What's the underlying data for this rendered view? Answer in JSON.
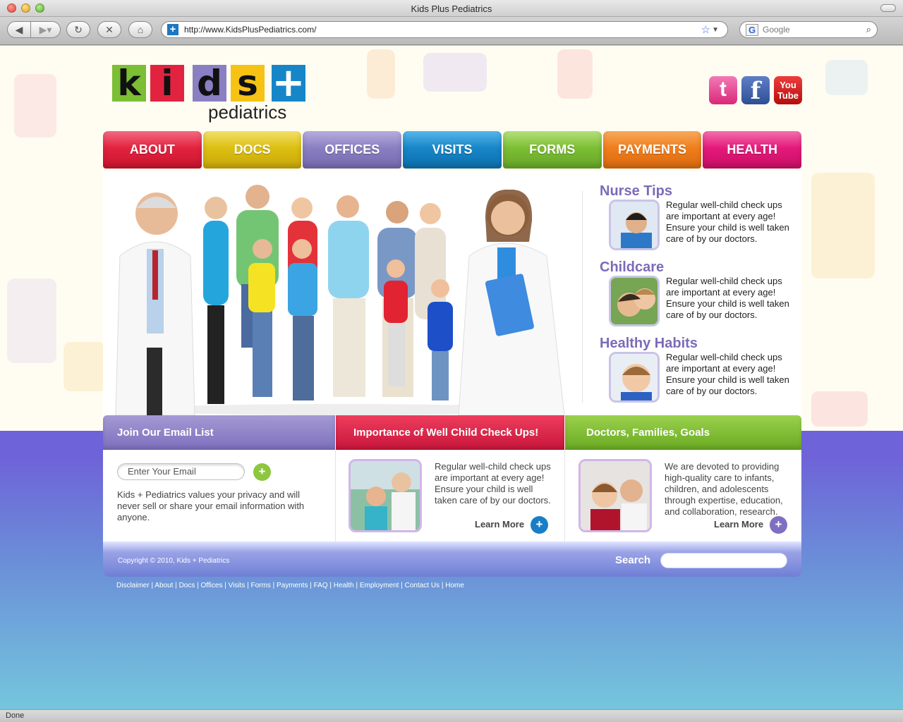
{
  "window": {
    "title": "Kids Plus Pediatrics"
  },
  "browser": {
    "url": "http://www.KidsPlusPediatrics.com/",
    "search_placeholder": "Google",
    "status": "Done"
  },
  "logo": {
    "letters": [
      "k",
      "i",
      "d",
      "s",
      "+"
    ],
    "subtitle": "pediatrics"
  },
  "social": [
    {
      "name": "twitter",
      "glyph": "t",
      "color": "#e83d8e"
    },
    {
      "name": "facebook",
      "glyph": "f",
      "color": "#3b5998"
    },
    {
      "name": "youtube",
      "glyph": "You Tube",
      "color": "#d9161a"
    }
  ],
  "nav": [
    "ABOUT",
    "DOCS",
    "OFFICES",
    "VISITS",
    "FORMS",
    "PAYMENTS",
    "HEALTH"
  ],
  "colors": {
    "nav": [
      "#e2233f",
      "#dcbf12",
      "#8a7fc2",
      "#1786c9",
      "#7cbe34",
      "#f07e1d",
      "#e5197a"
    ],
    "accent_purple": "#7c6bb8",
    "accent_blue": "#1a7ec6"
  },
  "tips": [
    {
      "title": "Nurse Tips",
      "text": "Regular well-child check ups are important at every age! Ensure your child is well taken care of by our doctors."
    },
    {
      "title": "Childcare",
      "text": "Regular well-child check ups are important at every age! Ensure your child is well taken care of by our doctors."
    },
    {
      "title": "Healthy Habits",
      "text": "Regular well-child check ups are important at every age! Ensure your child is well taken care of by our doctors."
    }
  ],
  "sections": {
    "email": {
      "title": "Join Our Email List",
      "placeholder": "Enter Your Email",
      "privacy": "Kids + Pediatrics values your privacy and will never sell or share your email information with anyone."
    },
    "checkups": {
      "title": "Importance of Well Child Check Ups!",
      "text": "Regular well-child check ups are important at every age! Ensure your child is well taken care of by our doctors.",
      "learn_more": "Learn More"
    },
    "families": {
      "title": "Doctors, Families, Goals",
      "text": "We are devoted to providing high-quality care to infants, children, and adolescents through expertise, education, and collaboration, research.",
      "learn_more": "Learn More"
    }
  },
  "footer": {
    "copyright": "Copyright © 2010, Kids + Pediatrics",
    "search_label": "Search",
    "links": [
      "Disclaimer",
      "About",
      "Docs",
      "Offices",
      "Visits",
      "Forms",
      "Payments",
      "FAQ",
      "Health",
      "Employment",
      "Contact Us",
      "Home"
    ]
  }
}
